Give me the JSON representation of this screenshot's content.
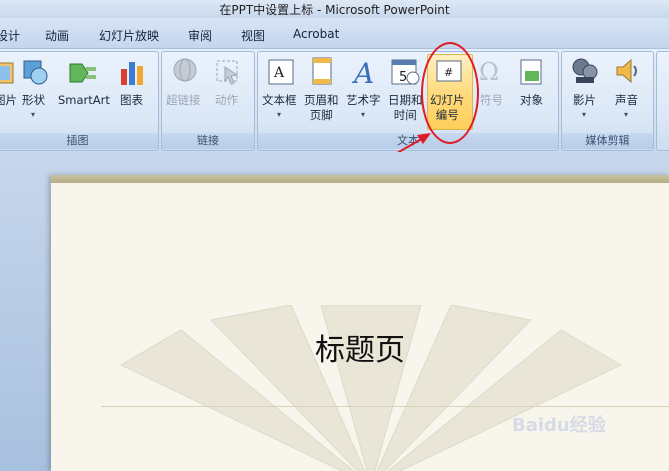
{
  "window": {
    "title": "在PPT中设置上标 - Microsoft PowerPoint"
  },
  "tabs": [
    "设计",
    "动画",
    "幻灯片放映",
    "审阅",
    "视图",
    "Acrobat"
  ],
  "groups": {
    "illustrations": {
      "name": "插图",
      "buttons": [
        {
          "label": "图片",
          "icon": "picture-icon"
        },
        {
          "label": "形状",
          "icon": "shapes-icon",
          "dropdown": "▾"
        },
        {
          "label": "SmartArt",
          "icon": "smartart-icon"
        },
        {
          "label": "图表",
          "icon": "chart-icon"
        }
      ]
    },
    "links": {
      "name": "链接",
      "buttons": [
        {
          "label": "超链接",
          "icon": "hyperlink-icon",
          "disabled": true
        },
        {
          "label": "动作",
          "icon": "action-icon",
          "disabled": true
        }
      ]
    },
    "text": {
      "name": "文本",
      "buttons": [
        {
          "label_1": "文本框",
          "label_2": "",
          "icon": "textbox-icon",
          "dropdown": "▾"
        },
        {
          "label_1": "页眉和",
          "label_2": "页脚",
          "icon": "header-footer-icon"
        },
        {
          "label_1": "艺术字",
          "label_2": "",
          "icon": "wordart-icon",
          "dropdown": "▾"
        },
        {
          "label_1": "日期和",
          "label_2": "时间",
          "icon": "date-time-icon"
        },
        {
          "label_1": "幻灯片",
          "label_2": "编号",
          "icon": "slide-number-icon",
          "highlighted": true
        },
        {
          "label_1": "符号",
          "label_2": "",
          "icon": "symbol-icon",
          "disabled": true
        },
        {
          "label_1": "对象",
          "label_2": "",
          "icon": "object-icon"
        }
      ]
    },
    "media": {
      "name": "媒体剪辑",
      "buttons": [
        {
          "label": "影片",
          "icon": "movie-icon",
          "dropdown": "▾"
        },
        {
          "label": "声音",
          "icon": "sound-icon",
          "dropdown": "▾"
        }
      ]
    }
  },
  "slide": {
    "title": "标题页"
  },
  "watermark": "Baidu经验",
  "colors": {
    "annotation": "#e01b25",
    "highlight": "#ffd978"
  }
}
